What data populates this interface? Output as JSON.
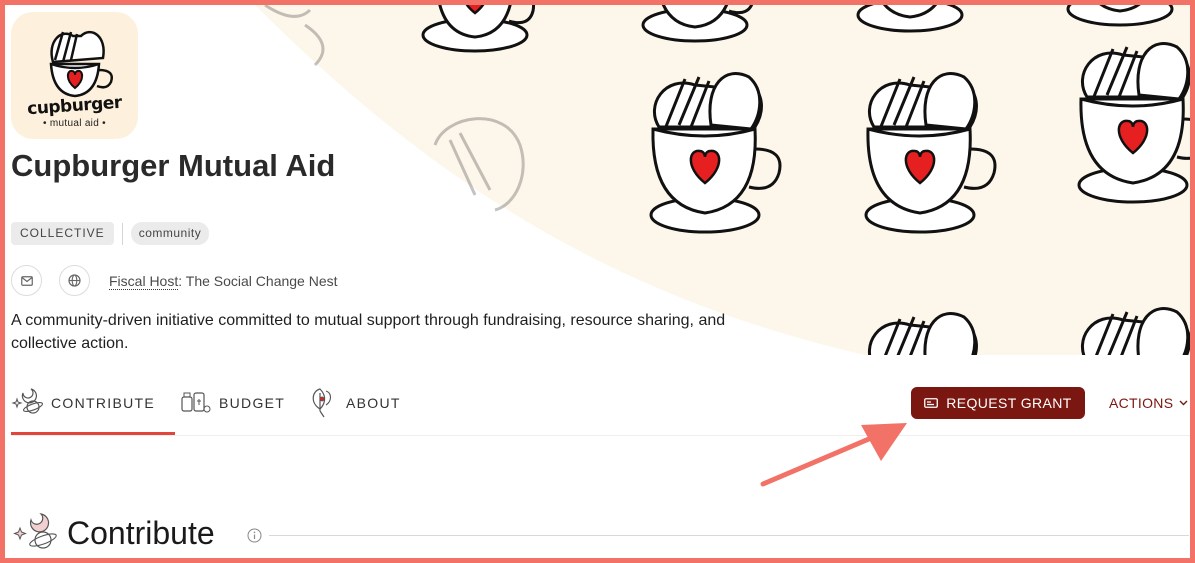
{
  "profile": {
    "logo": {
      "brand": "cupburger",
      "subtitle": "• mutual aid •"
    },
    "name": "Cupburger Mutual Aid",
    "type_tag": "COLLECTIVE",
    "tags": [
      "community"
    ],
    "fiscal_host_label": "Fiscal Host",
    "fiscal_host_value": ": The Social Change Nest",
    "description": "A community-driven initiative committed to mutual support through fundraising, resource sharing, and collective action."
  },
  "nav": {
    "tabs": [
      {
        "label": "CONTRIBUTE",
        "icon": "contribute-icon",
        "active": true
      },
      {
        "label": "BUDGET",
        "icon": "budget-icon",
        "active": false
      },
      {
        "label": "ABOUT",
        "icon": "about-icon",
        "active": false
      }
    ],
    "request_grant_label": "REQUEST GRANT",
    "actions_label": "ACTIONS"
  },
  "section": {
    "title": "Contribute"
  },
  "colors": {
    "accent": "#7a1711",
    "active_tab": "#e2453a",
    "banner_bg": "#fdf6ea",
    "heart": "#e62020",
    "annotation_arrow": "#f27267"
  }
}
